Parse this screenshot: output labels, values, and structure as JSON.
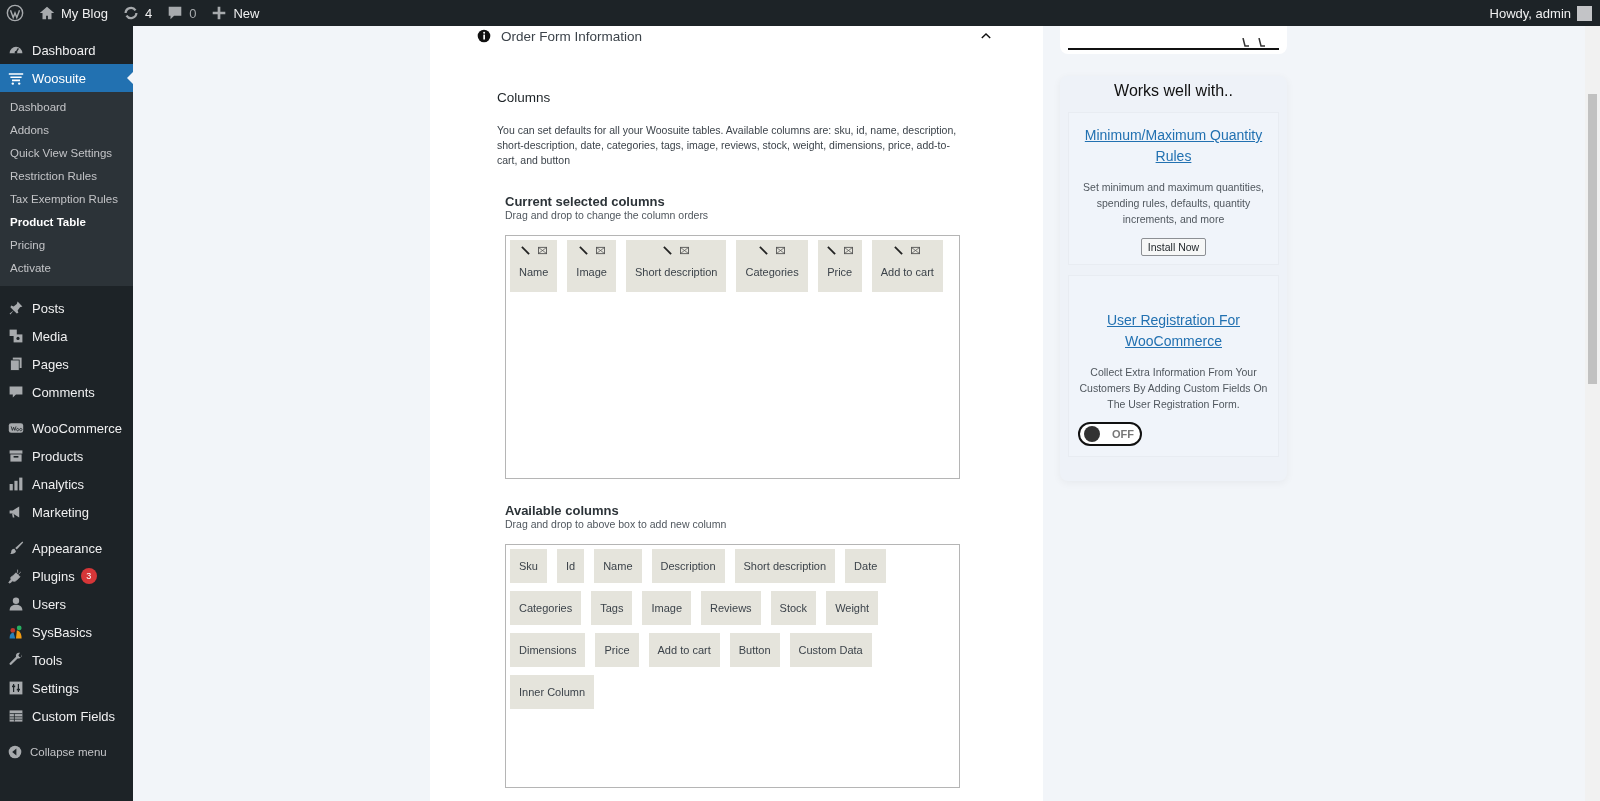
{
  "top_bar": {
    "site_name": "My Blog",
    "updates": "4",
    "comments": "0",
    "new_label": "New",
    "greeting": "Howdy, admin"
  },
  "sidebar": {
    "groups": [
      [
        {
          "label": "Dashboard",
          "selected": false
        },
        {
          "label": "Woosuite",
          "selected": true,
          "children": [
            {
              "label": "Dashboard",
              "selected": false
            },
            {
              "label": "Addons",
              "selected": false
            },
            {
              "label": "Quick View Settings",
              "selected": false
            },
            {
              "label": "Restriction Rules",
              "selected": false
            },
            {
              "label": "Tax Exemption Rules",
              "selected": false
            },
            {
              "label": "Product Table",
              "selected": true
            },
            {
              "label": "Pricing",
              "selected": false
            },
            {
              "label": "Activate",
              "selected": false
            }
          ]
        }
      ],
      [
        {
          "label": "Posts",
          "selected": false
        },
        {
          "label": "Media",
          "selected": false
        },
        {
          "label": "Pages",
          "selected": false
        },
        {
          "label": "Comments",
          "selected": false
        }
      ],
      [
        {
          "label": "WooCommerce",
          "selected": false
        },
        {
          "label": "Products",
          "selected": false
        },
        {
          "label": "Analytics",
          "selected": false
        },
        {
          "label": "Marketing",
          "selected": false
        }
      ],
      [
        {
          "label": "Appearance",
          "selected": false
        },
        {
          "label": "Plugins",
          "selected": false,
          "badge": "3"
        },
        {
          "label": "Users",
          "selected": false
        },
        {
          "label": "SysBasics",
          "selected": false
        },
        {
          "label": "Tools",
          "selected": false
        },
        {
          "label": "Settings",
          "selected": false
        },
        {
          "label": "Custom Fields",
          "selected": false
        }
      ]
    ],
    "collapse_label": "Collapse menu"
  },
  "panel": {
    "title": "Order Form Information",
    "expanded": true,
    "section_title": "Columns",
    "description": "You can set defaults for all your Woosuite tables. Available columns are: sku, id, name, description, short-description, date, categories, tags, image, reviews, stock, weight, dimensions, price, add-to-cart, and button",
    "selected_columns": {
      "title": "Current selected columns",
      "hint": "Drag and drop to change the column orders",
      "items": [
        "Name",
        "Image",
        "Short description",
        "Categories",
        "Price",
        "Add to cart"
      ]
    },
    "available_columns": {
      "title": "Available columns",
      "hint": "Drag and drop to above box to add new column",
      "items": [
        "Sku",
        "Id",
        "Name",
        "Description",
        "Short description",
        "Date",
        "Categories",
        "Tags",
        "Image",
        "Reviews",
        "Stock",
        "Weight",
        "Dimensions",
        "Price",
        "Add to cart",
        "Button",
        "Custom Data",
        "Inner Column"
      ]
    }
  },
  "promo": {
    "title": "Works well with..",
    "plugins": [
      {
        "kind": "button",
        "name": "Minimum/Maximum Quantity Rules",
        "description": "Set minimum and maximum quantities, spending rules, defaults, quantity increments, and more",
        "button": "Install Now"
      },
      {
        "kind": "toggle",
        "name": "User Registration For WooCommerce",
        "description": "Collect Extra Information From Your Customers By Adding Custom Fields On The User Registration Form.",
        "toggle_label": "OFF",
        "on": false
      }
    ]
  }
}
